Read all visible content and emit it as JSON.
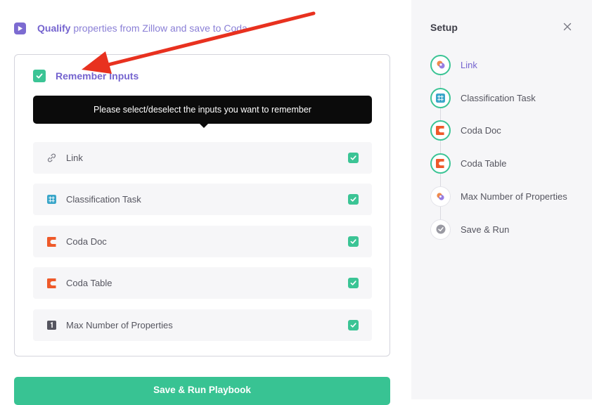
{
  "header": {
    "strong": "Qualify",
    "rest": " properties from Zillow and save to Coda",
    "icon": "play-icon",
    "accent": "#7564cf"
  },
  "remember": {
    "label": "Remember Inputs",
    "checked": true
  },
  "tooltip": {
    "text": "Please select/deselect the inputs you want to remember"
  },
  "inputs": [
    {
      "label": "Link",
      "icon": "link-icon",
      "checked": true
    },
    {
      "label": "Classification Task",
      "icon": "grid-icon",
      "checked": true
    },
    {
      "label": "Coda Doc",
      "icon": "coda-icon",
      "checked": true
    },
    {
      "label": "Coda Table",
      "icon": "coda-icon",
      "checked": true
    },
    {
      "label": "Max Number of Properties",
      "icon": "number-one-icon",
      "checked": true
    }
  ],
  "save_button": {
    "label": "Save & Run Playbook",
    "color": "#38c393"
  },
  "setup": {
    "title": "Setup",
    "steps": [
      {
        "label": "Link",
        "icon": "bardeen-logo-icon",
        "state": "active"
      },
      {
        "label": "Classification Task",
        "icon": "grid-icon",
        "state": "done"
      },
      {
        "label": "Coda Doc",
        "icon": "coda-icon",
        "state": "done"
      },
      {
        "label": "Coda Table",
        "icon": "coda-icon",
        "state": "done"
      },
      {
        "label": "Max Number of Properties",
        "icon": "bardeen-logo-icon",
        "state": "pending"
      },
      {
        "label": "Save & Run",
        "icon": "check-circle-icon",
        "state": "pending"
      }
    ]
  },
  "annotation": {
    "icon": "red-arrow-icon",
    "color": "#e8311f"
  }
}
